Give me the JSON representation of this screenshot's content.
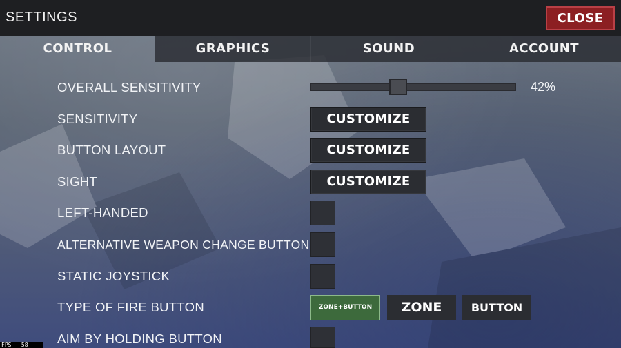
{
  "header": {
    "title": "SETTINGS",
    "close_label": "CLOSE"
  },
  "tabs": [
    {
      "label": "CONTROL",
      "active": true
    },
    {
      "label": "GRAPHICS",
      "active": false
    },
    {
      "label": "SOUND",
      "active": false
    },
    {
      "label": "ACCOUNT",
      "active": false
    }
  ],
  "settings": {
    "overall_sensitivity": {
      "label": "OVERALL SENSITIVITY",
      "value_text": "42%",
      "value": 0.42
    },
    "sensitivity": {
      "label": "SENSITIVITY",
      "button": "CUSTOMIZE"
    },
    "button_layout": {
      "label": "BUTTON LAYOUT",
      "button": "CUSTOMIZE"
    },
    "sight": {
      "label": "SIGHT",
      "button": "CUSTOMIZE"
    },
    "left_handed": {
      "label": "LEFT-HANDED",
      "checked": false
    },
    "alt_weapon_change": {
      "label": "ALTERNATIVE WEAPON CHANGE BUTTON",
      "checked": false
    },
    "static_joystick": {
      "label": "STATIC JOYSTICK",
      "checked": false
    },
    "fire_button_type": {
      "label": "TYPE OF FIRE BUTTON",
      "options": [
        "ZONE+BUTTON",
        "ZONE",
        "BUTTON"
      ],
      "selected": "ZONE+BUTTON"
    },
    "aim_by_holding": {
      "label": "AIM BY HOLDING BUTTON",
      "checked": false
    }
  },
  "fps": {
    "label": "FPS",
    "value": "58"
  },
  "colors": {
    "close": "#8c1f22",
    "selected_option": "#3d6a3c",
    "top_bar": "#1e1f22"
  }
}
